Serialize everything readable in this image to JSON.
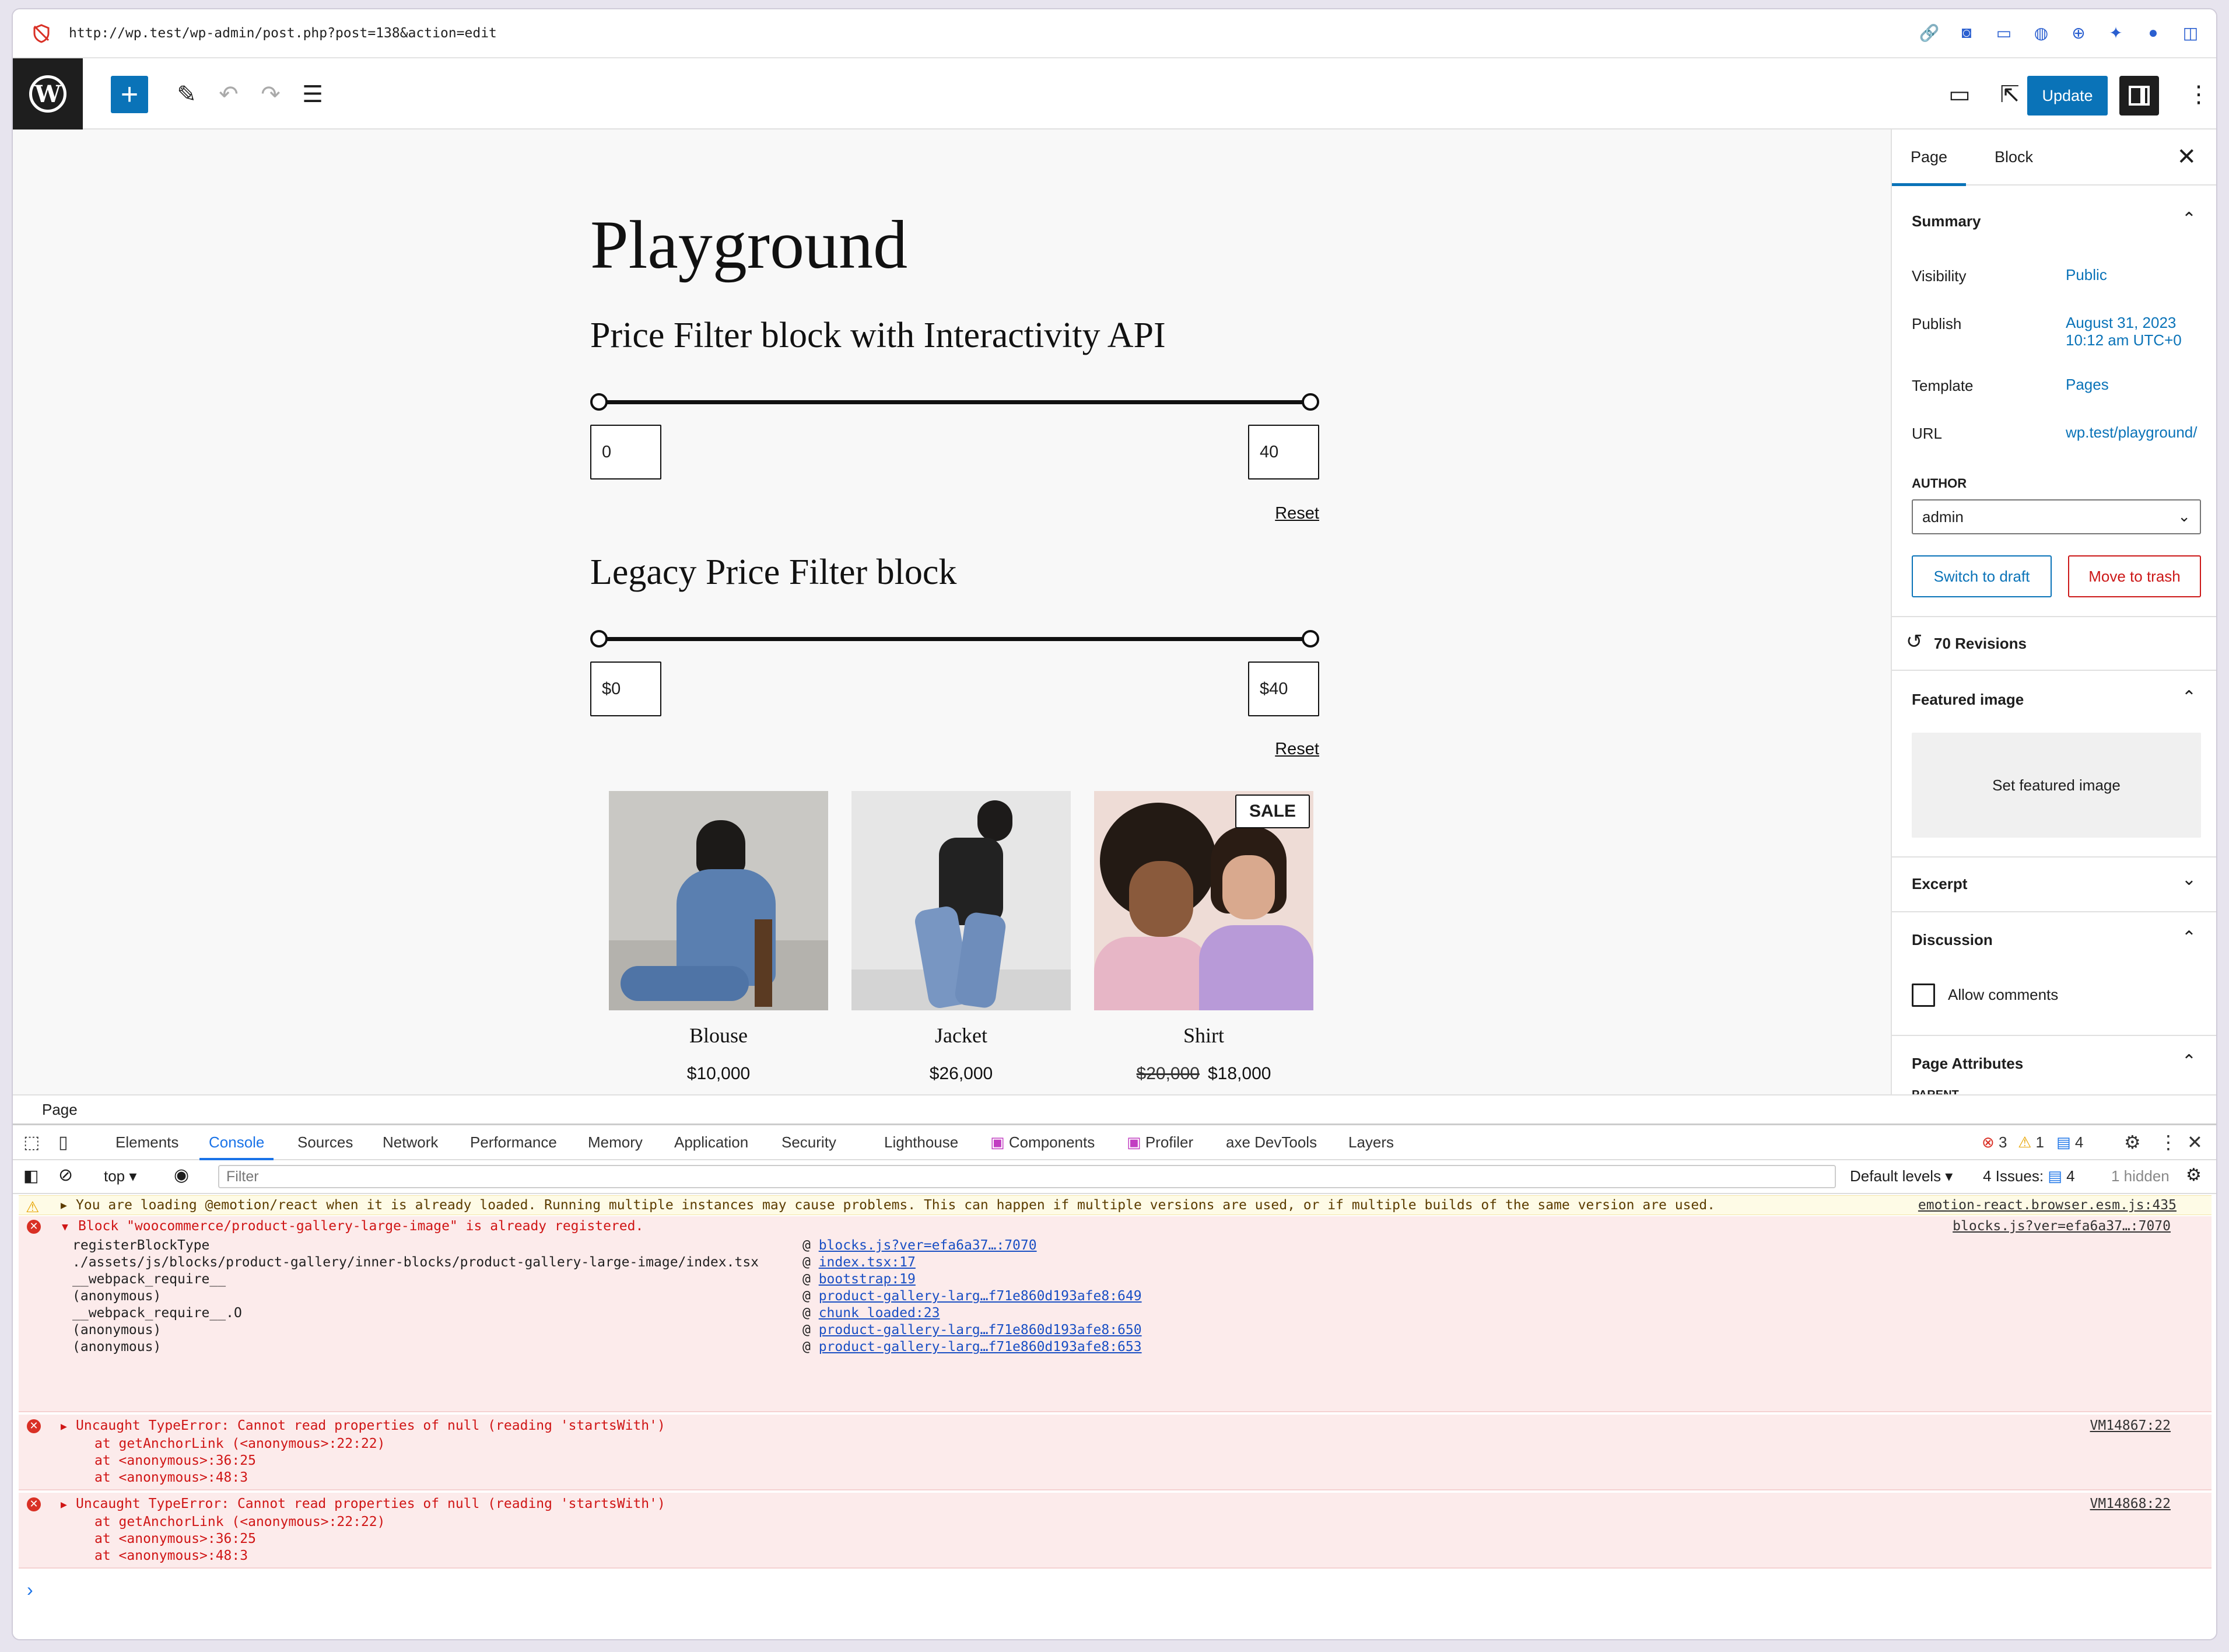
{
  "browser": {
    "url": "http://wp.test/wp-admin/post.php?post=138&action=edit"
  },
  "editor": {
    "update_label": "Update",
    "title": "Playground",
    "price_filter_heading": "Price Filter block with Interactivity API",
    "price_min": "0",
    "price_max": "40",
    "reset_label": "Reset",
    "legacy_heading": "Legacy Price Filter block",
    "legacy_min": "$0",
    "legacy_max": "$40",
    "legacy_reset_label": "Reset",
    "products": [
      {
        "name": "Blouse",
        "price": "$10,000"
      },
      {
        "name": "Jacket",
        "price": "$26,000"
      },
      {
        "name": "Shirt",
        "old_price": "$20,000",
        "price": "$18,000",
        "badge": "SALE"
      }
    ]
  },
  "sidebar": {
    "tab_page": "Page",
    "tab_block": "Block",
    "summary": "Summary",
    "visibility_label": "Visibility",
    "visibility_value": "Public",
    "publish_label": "Publish",
    "publish_value": "August 31, 2023 10:12 am UTC+0",
    "template_label": "Template",
    "template_value": "Pages",
    "url_label": "URL",
    "url_value": "wp.test/playground/",
    "author_label": "AUTHOR",
    "author_value": "admin",
    "switch_draft": "Switch to draft",
    "move_trash": "Move to trash",
    "revisions": "70 Revisions",
    "featured_image": "Featured image",
    "set_featured": "Set featured image",
    "excerpt": "Excerpt",
    "discussion": "Discussion",
    "allow_comments": "Allow comments",
    "page_attributes": "Page Attributes",
    "parent": "PARENT"
  },
  "breadcrumb": "Page",
  "devtools": {
    "tabs": [
      "Elements",
      "Console",
      "Sources",
      "Network",
      "Performance",
      "Memory",
      "Application",
      "Security",
      "Lighthouse",
      "Components",
      "Profiler",
      "axe DevTools",
      "Layers"
    ],
    "errors_count": "3",
    "warnings_count": "1",
    "messages_count": "4",
    "context": "top",
    "filter_placeholder": "Filter",
    "levels": "Default levels",
    "issues": "4 Issues:",
    "issues_count": "4",
    "hidden": "1 hidden",
    "warning_msg": "You are loading @emotion/react when it is already loaded. Running multiple instances may cause problems. This can happen if multiple versions are used, or if multiple builds of the same version are used.",
    "warning_src": "emotion-react.browser.esm.js:435",
    "error1_msg": "Block \"woocommerce/product-gallery-large-image\" is already registered.",
    "error1_src": "blocks.js?ver=efa6a37…:7070",
    "error1_trace": [
      {
        "fn": "registerBlockType",
        "loc": "blocks.js?ver=efa6a37…:7070"
      },
      {
        "fn": "./assets/js/blocks/product-gallery/inner-blocks/product-gallery-large-image/index.tsx",
        "loc": "index.tsx:17"
      },
      {
        "fn": "__webpack_require__",
        "loc": "bootstrap:19"
      },
      {
        "fn": "(anonymous)",
        "loc": "product-gallery-larg…f71e860d193afe8:649"
      },
      {
        "fn": "__webpack_require__.O",
        "loc": "chunk loaded:23"
      },
      {
        "fn": "(anonymous)",
        "loc": "product-gallery-larg…f71e860d193afe8:650"
      },
      {
        "fn": "(anonymous)",
        "loc": "product-gallery-larg…f71e860d193afe8:653"
      }
    ],
    "error2_msg": "Uncaught TypeError: Cannot read properties of null (reading 'startsWith')",
    "error2_src": "VM14867:22",
    "error2_stack": [
      "at getAnchorLink (<anonymous>:22:22)",
      "at <anonymous>:36:25",
      "at <anonymous>:48:3"
    ],
    "error3_msg": "Uncaught TypeError: Cannot read properties of null (reading 'startsWith')",
    "error3_src": "VM14868:22",
    "error3_stack": [
      "at getAnchorLink (<anonymous>:22:22)",
      "at <anonymous>:36:25",
      "at <anonymous>:48:3"
    ],
    "prompt": "›"
  },
  "colors": {
    "wp_blue": "#0a73b8",
    "error_red": "#d01616",
    "devtools_blue": "#1a73e8",
    "trash_red": "#cc1818"
  }
}
